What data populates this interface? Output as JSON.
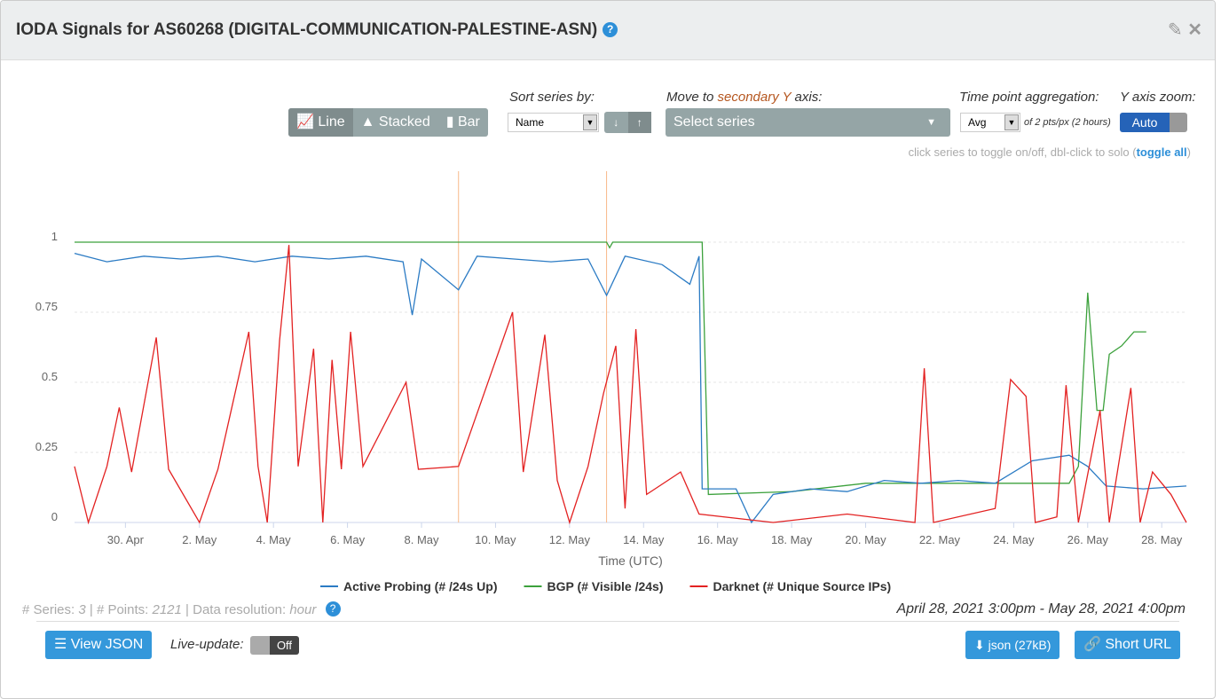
{
  "header": {
    "title": "IODA Signals for AS60268 (DIGITAL-COMMUNICATION-PALESTINE-ASN)",
    "help_icon": "question-circle-icon",
    "edit_icon": "edit-icon",
    "close_icon": "close-icon"
  },
  "toolbar": {
    "chart_types": [
      "Line",
      "Stacked",
      "Bar"
    ],
    "active_type": "Line",
    "sort_label": "Sort series by:",
    "sort_value": "Name",
    "secondary_label_pre": "Move to ",
    "secondary_label_hl": "secondary Y",
    "secondary_label_post": " axis:",
    "secondary_placeholder": "Select series",
    "agg_label": "Time point aggregation:",
    "agg_value": "Avg",
    "agg_note": "of 2 pts/px (2 hours)",
    "zoom_label": "Y axis zoom:",
    "zoom_value": "Auto",
    "hint": "click series to toggle on/off, dbl-click to solo (",
    "hint_link": "toggle all",
    "hint_end": ")"
  },
  "chart_data": {
    "type": "line",
    "xlabel": "Time (UTC)",
    "ylabel": "",
    "ylim": [
      0,
      1.05
    ],
    "xlim": [
      "2021-04-28 15:00",
      "2021-05-28 16:00"
    ],
    "yticks": [
      "0",
      "0.25",
      "0.5",
      "0.75",
      "1"
    ],
    "xticks": [
      "30. Apr",
      "2. May",
      "4. May",
      "6. May",
      "8. May",
      "10. May",
      "12. May",
      "14. May",
      "16. May",
      "18. May",
      "20. May",
      "22. May",
      "24. May",
      "26. May",
      "28. May"
    ],
    "vertical_markers": [
      "2021-05-09 00:00",
      "2021-05-13 00:00"
    ],
    "legend": "bottom",
    "series": [
      {
        "name": "Active Probing (# /24s Up)",
        "color": "#2b7bc4",
        "points": [
          [
            "2021-04-28 15:00",
            0.96
          ],
          [
            "2021-04-29 12:00",
            0.93
          ],
          [
            "2021-04-30 12:00",
            0.95
          ],
          [
            "2021-05-01 12:00",
            0.94
          ],
          [
            "2021-05-02 12:00",
            0.95
          ],
          [
            "2021-05-03 12:00",
            0.93
          ],
          [
            "2021-05-04 12:00",
            0.95
          ],
          [
            "2021-05-05 12:00",
            0.94
          ],
          [
            "2021-05-06 12:00",
            0.95
          ],
          [
            "2021-05-07 12:00",
            0.93
          ],
          [
            "2021-05-07 18:00",
            0.74
          ],
          [
            "2021-05-08 00:00",
            0.94
          ],
          [
            "2021-05-09 00:00",
            0.83
          ],
          [
            "2021-05-09 12:00",
            0.95
          ],
          [
            "2021-05-10 12:00",
            0.94
          ],
          [
            "2021-05-11 12:00",
            0.93
          ],
          [
            "2021-05-12 12:00",
            0.94
          ],
          [
            "2021-05-13 00:00",
            0.81
          ],
          [
            "2021-05-13 12:00",
            0.95
          ],
          [
            "2021-05-14 12:00",
            0.92
          ],
          [
            "2021-05-15 06:00",
            0.85
          ],
          [
            "2021-05-15 12:00",
            0.95
          ],
          [
            "2021-05-15 14:00",
            0.12
          ],
          [
            "2021-05-16 12:00",
            0.12
          ],
          [
            "2021-05-16 22:00",
            0.0
          ],
          [
            "2021-05-17 12:00",
            0.1
          ],
          [
            "2021-05-18 12:00",
            0.12
          ],
          [
            "2021-05-19 12:00",
            0.11
          ],
          [
            "2021-05-20 12:00",
            0.15
          ],
          [
            "2021-05-21 12:00",
            0.14
          ],
          [
            "2021-05-22 12:00",
            0.15
          ],
          [
            "2021-05-23 12:00",
            0.14
          ],
          [
            "2021-05-24 12:00",
            0.22
          ],
          [
            "2021-05-25 12:00",
            0.24
          ],
          [
            "2021-05-26 00:00",
            0.2
          ],
          [
            "2021-05-26 12:00",
            0.13
          ],
          [
            "2021-05-27 12:00",
            0.12
          ],
          [
            "2021-05-28 16:00",
            0.13
          ]
        ]
      },
      {
        "name": "BGP (# Visible /24s)",
        "color": "#3ca13c",
        "points": [
          [
            "2021-04-28 15:00",
            1.0
          ],
          [
            "2021-05-13 00:00",
            1.0
          ],
          [
            "2021-05-13 02:00",
            0.98
          ],
          [
            "2021-05-13 04:00",
            1.0
          ],
          [
            "2021-05-15 14:00",
            1.0
          ],
          [
            "2021-05-15 18:00",
            0.1
          ],
          [
            "2021-05-18 00:00",
            0.11
          ],
          [
            "2021-05-20 00:00",
            0.14
          ],
          [
            "2021-05-25 12:00",
            0.14
          ],
          [
            "2021-05-25 18:00",
            0.2
          ],
          [
            "2021-05-26 00:00",
            0.82
          ],
          [
            "2021-05-26 06:00",
            0.4
          ],
          [
            "2021-05-26 10:00",
            0.4
          ],
          [
            "2021-05-26 14:00",
            0.6
          ],
          [
            "2021-05-26 22:00",
            0.63
          ],
          [
            "2021-05-27 06:00",
            0.68
          ],
          [
            "2021-05-27 14:00",
            0.68
          ]
        ]
      },
      {
        "name": "Darknet (# Unique Source IPs)",
        "color": "#e32222",
        "points": [
          [
            "2021-04-28 15:00",
            0.2
          ],
          [
            "2021-04-29 00:00",
            0.0
          ],
          [
            "2021-04-29 12:00",
            0.2
          ],
          [
            "2021-04-29 20:00",
            0.41
          ],
          [
            "2021-04-30 04:00",
            0.18
          ],
          [
            "2021-04-30 20:00",
            0.66
          ],
          [
            "2021-05-01 04:00",
            0.19
          ],
          [
            "2021-05-02 00:00",
            0.0
          ],
          [
            "2021-05-02 12:00",
            0.19
          ],
          [
            "2021-05-03 08:00",
            0.68
          ],
          [
            "2021-05-03 14:00",
            0.2
          ],
          [
            "2021-05-03 20:00",
            0.0
          ],
          [
            "2021-05-04 04:00",
            0.65
          ],
          [
            "2021-05-04 10:00",
            0.99
          ],
          [
            "2021-05-04 16:00",
            0.2
          ],
          [
            "2021-05-05 02:00",
            0.62
          ],
          [
            "2021-05-05 08:00",
            0.0
          ],
          [
            "2021-05-05 14:00",
            0.58
          ],
          [
            "2021-05-05 20:00",
            0.19
          ],
          [
            "2021-05-06 02:00",
            0.68
          ],
          [
            "2021-05-06 10:00",
            0.2
          ],
          [
            "2021-05-07 14:00",
            0.5
          ],
          [
            "2021-05-07 22:00",
            0.19
          ],
          [
            "2021-05-09 00:00",
            0.2
          ],
          [
            "2021-05-10 11:00",
            0.75
          ],
          [
            "2021-05-10 18:00",
            0.18
          ],
          [
            "2021-05-11 08:00",
            0.67
          ],
          [
            "2021-05-11 16:00",
            0.15
          ],
          [
            "2021-05-12 00:00",
            0.0
          ],
          [
            "2021-05-12 12:00",
            0.2
          ],
          [
            "2021-05-12 22:00",
            0.46
          ],
          [
            "2021-05-13 06:00",
            0.63
          ],
          [
            "2021-05-13 12:00",
            0.05
          ],
          [
            "2021-05-13 19:00",
            0.69
          ],
          [
            "2021-05-14 02:00",
            0.1
          ],
          [
            "2021-05-15 00:00",
            0.18
          ],
          [
            "2021-05-15 12:00",
            0.03
          ],
          [
            "2021-05-17 12:00",
            0.0
          ],
          [
            "2021-05-19 12:00",
            0.03
          ],
          [
            "2021-05-21 08:00",
            0.0
          ],
          [
            "2021-05-21 14:00",
            0.55
          ],
          [
            "2021-05-21 20:00",
            0.0
          ],
          [
            "2021-05-23 12:00",
            0.05
          ],
          [
            "2021-05-23 22:00",
            0.51
          ],
          [
            "2021-05-24 08:00",
            0.45
          ],
          [
            "2021-05-24 14:00",
            0.0
          ],
          [
            "2021-05-25 04:00",
            0.02
          ],
          [
            "2021-05-25 10:00",
            0.49
          ],
          [
            "2021-05-25 18:00",
            0.0
          ],
          [
            "2021-05-26 08:00",
            0.4
          ],
          [
            "2021-05-26 14:00",
            0.0
          ],
          [
            "2021-05-27 04:00",
            0.48
          ],
          [
            "2021-05-27 10:00",
            0.0
          ],
          [
            "2021-05-27 18:00",
            0.18
          ],
          [
            "2021-05-28 06:00",
            0.1
          ],
          [
            "2021-05-28 16:00",
            0.0
          ]
        ]
      }
    ]
  },
  "footer": {
    "series_label": "# Series:",
    "series_count": "3",
    "points_label": "# Points:",
    "points_count": "2121",
    "resolution_label": "Data resolution:",
    "resolution": "hour",
    "range": "April 28, 2021 3:00pm - May 28, 2021 4:00pm",
    "view_json": "View JSON",
    "live_label": "Live-update:",
    "live_value": "Off",
    "json_btn": "json (27kB)",
    "short_url": "Short URL"
  }
}
